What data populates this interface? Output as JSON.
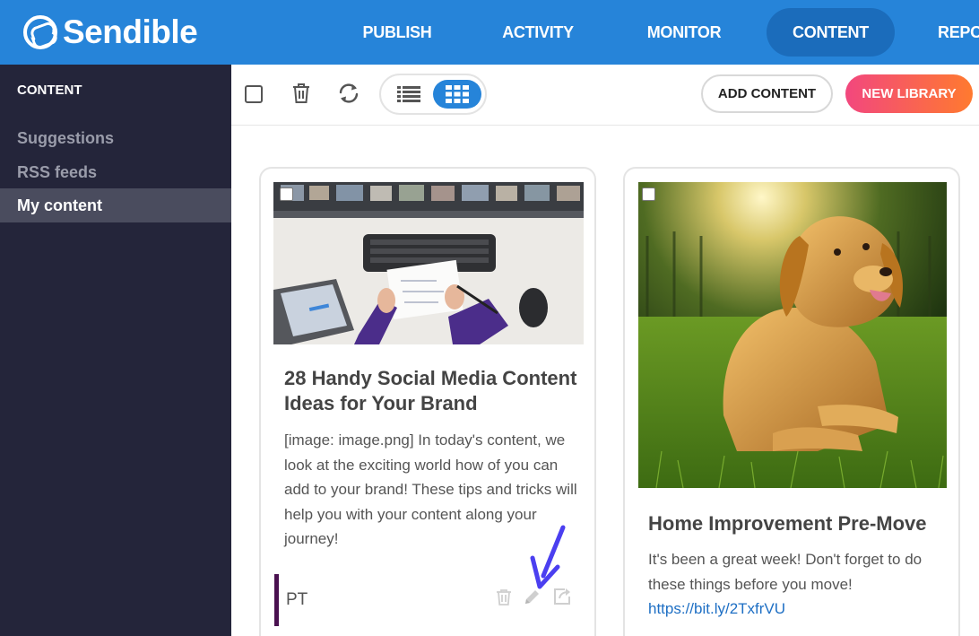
{
  "app": {
    "brand": "Sendible"
  },
  "nav": {
    "items": [
      {
        "label": "PUBLISH"
      },
      {
        "label": "ACTIVITY"
      },
      {
        "label": "MONITOR"
      },
      {
        "label": "CONTENT"
      },
      {
        "label": "REPO"
      }
    ],
    "active": "CONTENT",
    "colors": {
      "bar": "#2684d9",
      "active_pill": "#1b6cbb"
    }
  },
  "sidebar": {
    "heading": "CONTENT",
    "items": [
      {
        "label": "Suggestions"
      },
      {
        "label": "RSS feeds"
      },
      {
        "label": "My content"
      }
    ],
    "active": "My content"
  },
  "toolbar": {
    "icons": [
      "select-all-checkbox",
      "trash-icon",
      "refresh-icon",
      "list-view-icon",
      "grid-view-icon"
    ],
    "add_content": "ADD CONTENT",
    "new_library": "NEW LIBRARY"
  },
  "cards": [
    {
      "title": "28 Handy Social Media Content Ideas for Your Brand",
      "body": "[image: image.png] In today's content, we look at the exciting world how of you can add to your brand! These tips and tricks will help you with your content along your journey!",
      "tag": "PT",
      "image": "desk-keyboard-planner-photo",
      "actions": [
        "trash-icon",
        "edit-pencil-icon",
        "share-icon"
      ]
    },
    {
      "title": "Home Improvement Pre-Move",
      "body": "It's been a great week! Don't forget to do these things before you move!",
      "link": "https://bit.ly/2TxfrVU",
      "image": "golden-retriever-grass-photo"
    }
  ],
  "colors": {
    "sidebar": "#24253a",
    "gradient_start": "#f2477e",
    "gradient_end": "#ff7a2f",
    "annotation_arrow": "#4b3ff0"
  }
}
